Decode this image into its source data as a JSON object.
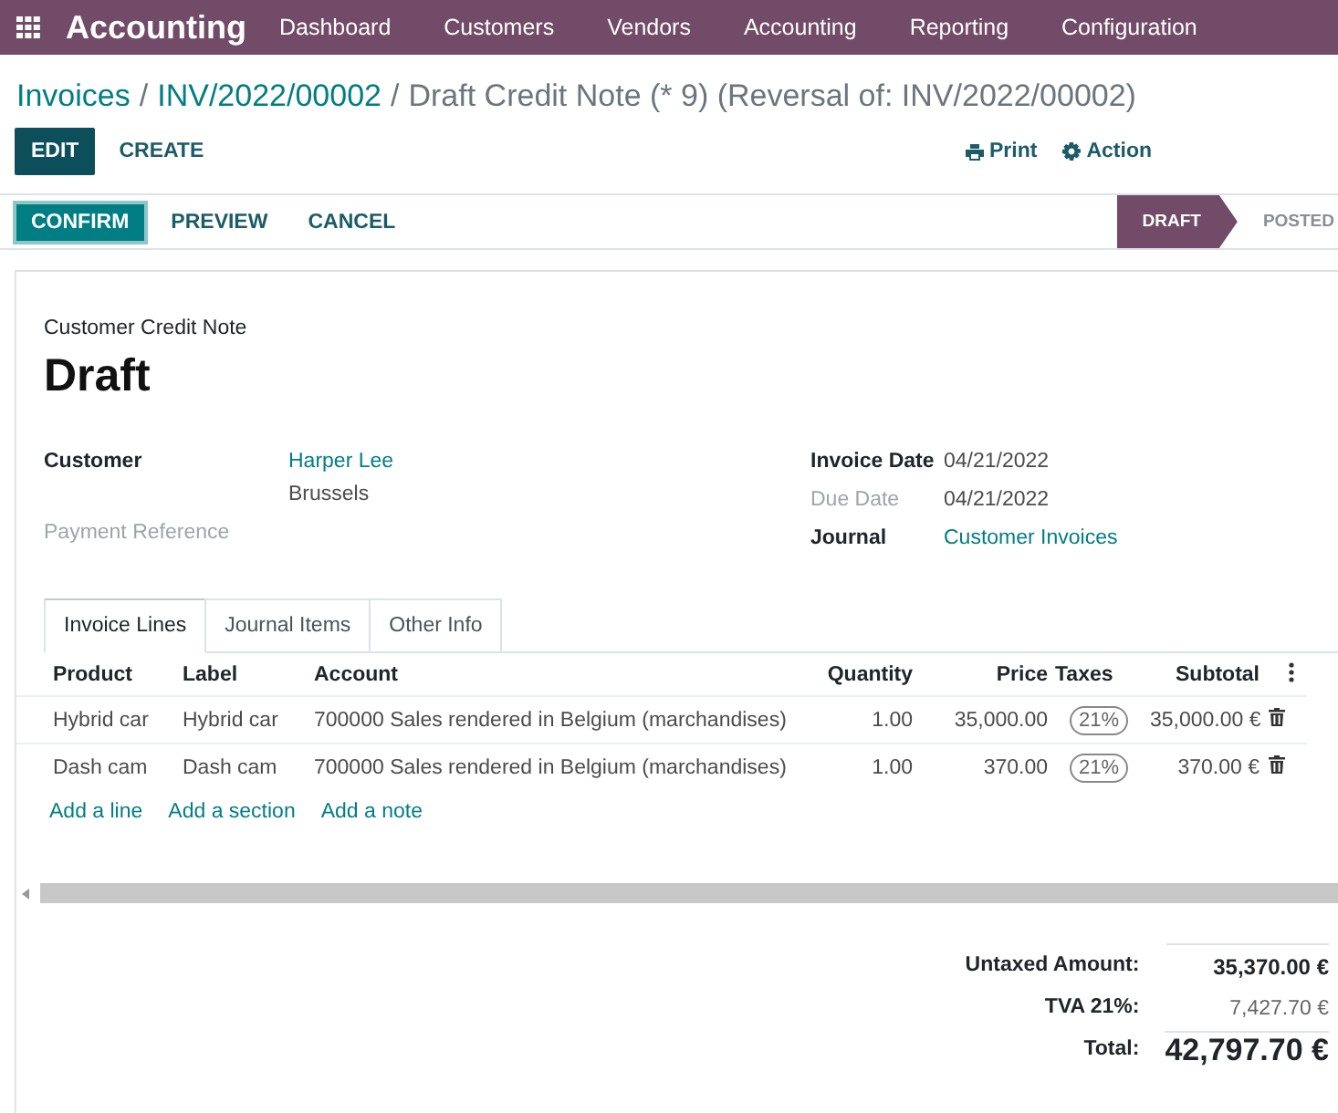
{
  "navbar": {
    "app_name": "Accounting",
    "menu": [
      "Dashboard",
      "Customers",
      "Vendors",
      "Accounting",
      "Reporting",
      "Configuration"
    ]
  },
  "breadcrumb": [
    {
      "text": "Invoices",
      "kind": "link"
    },
    {
      "text": "/",
      "kind": "separator"
    },
    {
      "text": "INV/2022/00002",
      "kind": "link"
    },
    {
      "text": "/",
      "kind": "separator"
    },
    {
      "text": "Draft Credit Note (* 9) (Reversal of: INV/2022/00002)",
      "kind": "current"
    }
  ],
  "buttons": [
    {
      "label": "EDIT",
      "kind": "primary"
    },
    {
      "label": "CREATE",
      "kind": "link"
    }
  ],
  "actions": [
    {
      "label": "Print",
      "kind": "print"
    },
    {
      "label": "Action",
      "kind": "gear"
    }
  ],
  "status_buttons": [
    {
      "label": "CONFIRM",
      "kind": "primary"
    },
    {
      "label": "PREVIEW",
      "kind": "link"
    },
    {
      "label": "CANCEL",
      "kind": "link"
    }
  ],
  "stages": [
    {
      "label": "DRAFT",
      "selected": true
    },
    {
      "label": "POSTED",
      "selected": false
    }
  ],
  "sheet": {
    "doc_type": "Customer Credit Note",
    "name": "Draft",
    "left_fields": [
      {
        "label": "Customer",
        "kind": "required",
        "values": [
          {
            "text": "Harper Lee",
            "kind": "link"
          },
          {
            "text": "Brussels",
            "kind": "text"
          }
        ]
      },
      {
        "label": "Payment Reference",
        "kind": "optional"
      }
    ],
    "right_fields": [
      {
        "label": "Invoice Date",
        "kind": "required",
        "values": [
          {
            "text": "04/21/2022",
            "kind": "text"
          }
        ]
      },
      {
        "label": "Due Date",
        "kind": "optional",
        "values": [
          {
            "text": "04/21/2022",
            "kind": "text"
          }
        ]
      },
      {
        "label": "Journal",
        "kind": "required",
        "values": [
          {
            "text": "Customer Invoices",
            "kind": "link"
          }
        ]
      }
    ],
    "tabs": [
      {
        "label": "Invoice Lines",
        "selected": true
      },
      {
        "label": "Journal Items",
        "selected": false
      },
      {
        "label": "Other Info",
        "selected": false
      }
    ],
    "table": {
      "columns": [
        "Product",
        "Label",
        "Account",
        "Quantity",
        "Price",
        "Taxes",
        "Subtotal"
      ],
      "rows": [
        {
          "product": "Hybrid car",
          "label": "Hybrid car",
          "account": "700000 Sales rendered in Belgium (marchandises)",
          "quantity": "1.00",
          "price": "35,000.00",
          "taxes": "21%",
          "subtotal": "35,000.00 €"
        },
        {
          "product": "Dash cam",
          "label": "Dash cam",
          "account": "700000 Sales rendered in Belgium (marchandises)",
          "quantity": "1.00",
          "price": "370.00",
          "taxes": "21%",
          "subtotal": "370.00 €"
        }
      ]
    },
    "add_links": [
      "Add a line",
      "Add a section",
      "Add a note"
    ],
    "totals": [
      {
        "label": "Untaxed Amount:",
        "value": "35,370.00 €",
        "kind": "subtotal"
      },
      {
        "label": "TVA 21%:",
        "value": "7,427.70 €",
        "kind": "tax"
      },
      {
        "label": "Total:",
        "value": "42,797.70 €",
        "kind": "total"
      }
    ]
  }
}
